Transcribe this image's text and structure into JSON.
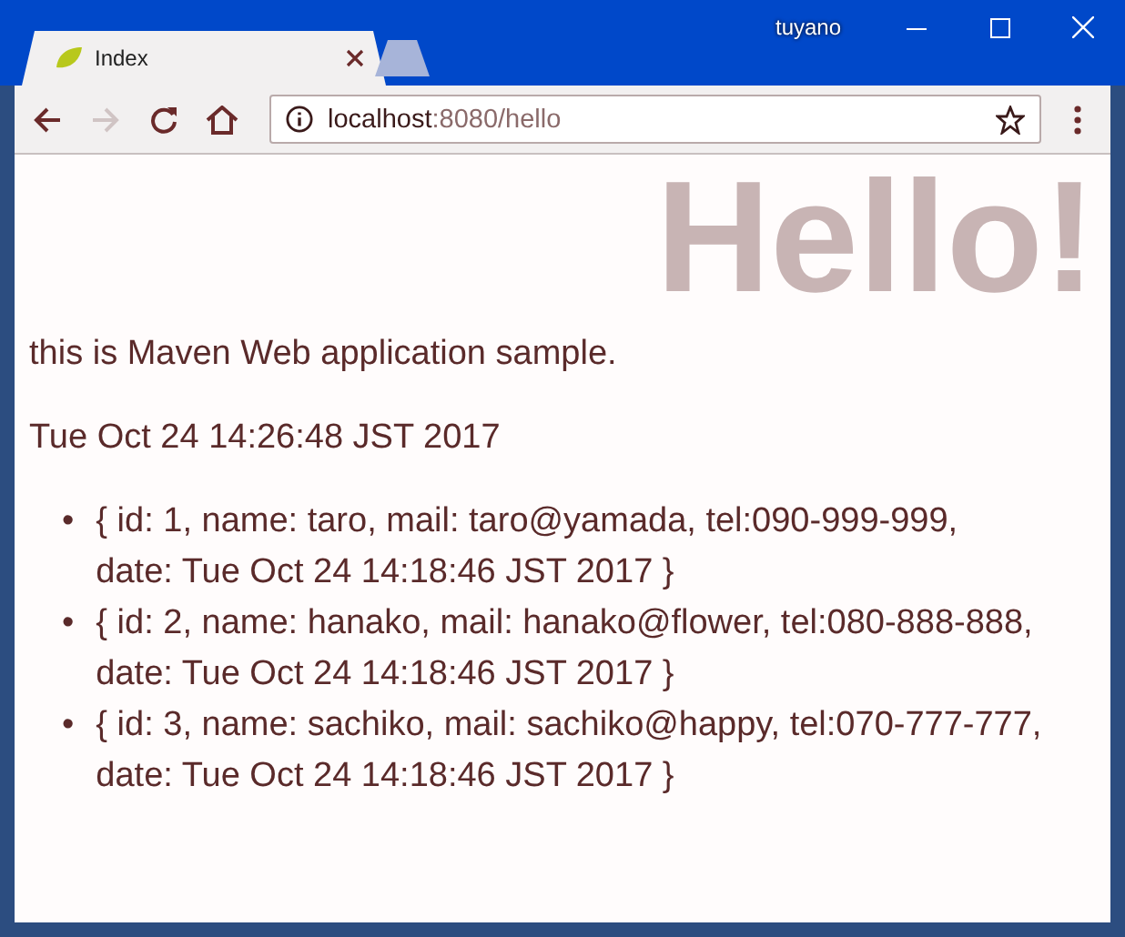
{
  "window": {
    "user": "tuyano"
  },
  "tabs": [
    {
      "title": "Index",
      "selected": true
    },
    {
      "selected": false
    }
  ],
  "address": {
    "host": "localhost",
    "path": ":8080/hello"
  },
  "page": {
    "heading": "Hello!",
    "intro": "this is Maven Web application sample.",
    "time": "Tue Oct 24 14:26:48 JST 2017",
    "items": [
      {
        "marker": "•",
        "text": "{ id: 1, name: taro, mail: taro@yamada, tel:090-999-999, date: Tue Oct 24 14:18:46 JST 2017 }"
      },
      {
        "marker": "•",
        "text": "{ id: 2, name: hanako, mail: hanako@flower, tel:080-888-888, date: Tue Oct 24 14:18:46 JST 2017 }"
      },
      {
        "marker": "•",
        "text": "{ id: 3, name: sachiko, mail: sachiko@happy, tel:070-777-777, date: Tue Oct 24 14:18:46 JST 2017 }"
      }
    ]
  }
}
